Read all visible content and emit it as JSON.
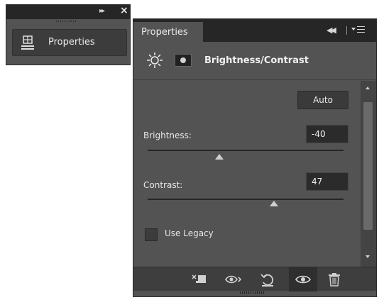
{
  "mini_panel": {
    "label": "Properties",
    "expand_icon": "double-chevron-right-icon",
    "close_icon": "close-icon"
  },
  "panel": {
    "tab_label": "Properties",
    "collapse_icon": "double-chevron-left-icon",
    "menu_icon": "panel-menu-icon"
  },
  "adjustment": {
    "title": "Brightness/Contrast",
    "icon": "brightness-sun-icon",
    "mask_icon": "layer-mask-icon",
    "auto_label": "Auto"
  },
  "fields": {
    "brightness": {
      "label": "Brightness:",
      "value": "-40",
      "min": -150,
      "max": 150
    },
    "contrast": {
      "label": "Contrast:",
      "value": "47",
      "min": -50,
      "max": 100
    }
  },
  "legacy": {
    "label": "Use Legacy",
    "checked": false
  },
  "bottom_icons": [
    "clip-to-layer-icon",
    "view-previous-state-icon",
    "reset-icon",
    "visibility-eye-icon",
    "trash-icon"
  ],
  "colors": {
    "panel_bg": "#535353",
    "title_bar": "#262626",
    "field_bg": "#2b2b2b",
    "text": "#e6e6e6"
  }
}
